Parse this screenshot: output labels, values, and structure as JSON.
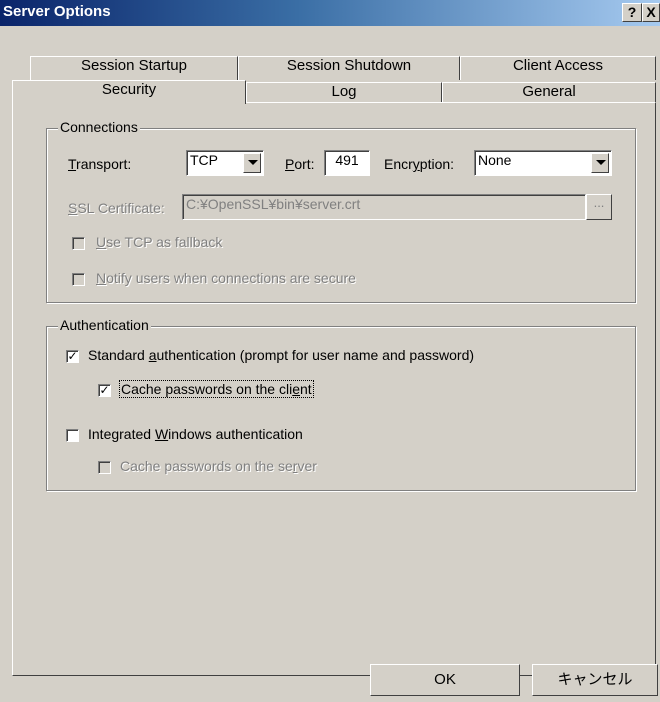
{
  "window": {
    "title": "Server Options",
    "help_label": "?",
    "close_label": "X"
  },
  "tabs": {
    "back": [
      "Session Startup",
      "Session Shutdown",
      "Client Access"
    ],
    "front": [
      "Security",
      "Log",
      "General"
    ]
  },
  "connections": {
    "legend": "Connections",
    "transport_label": "Transport:",
    "transport_value": "TCP",
    "port_label": "Port:",
    "port_value": "491",
    "encryption_label": "Encryption:",
    "encryption_value": "None",
    "ssl_label": "SSL Certificate:",
    "ssl_value": "C:¥OpenSSL¥bin¥server.crt",
    "browse_label": "...",
    "use_tcp_fallback": "Use TCP as fallback",
    "notify_secure": "Notify users when connections are secure"
  },
  "authentication": {
    "legend": "Authentication",
    "standard": "Standard authentication (prompt for user name and password)",
    "standard_checked": true,
    "cache_client": "Cache passwords on the client",
    "cache_client_checked": true,
    "integrated": "Integrated Windows authentication",
    "integrated_checked": false,
    "cache_server": "Cache passwords on the server",
    "cache_server_checked": false
  },
  "buttons": {
    "ok": "OK",
    "cancel": "キャンセル"
  },
  "colors": {
    "face": "#d4d0c8",
    "title_start": "#0a246a",
    "title_end": "#a6caf0"
  }
}
